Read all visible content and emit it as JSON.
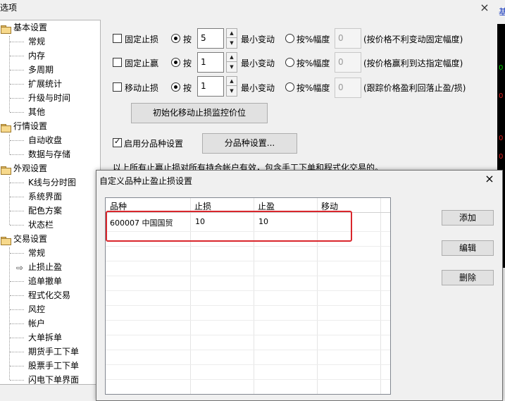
{
  "window": {
    "title": "选项",
    "close_icon": "×"
  },
  "tree": {
    "categories": [
      {
        "label": "基本设置",
        "items": [
          "常规",
          "内存",
          "多周期",
          "扩展统计",
          "升级与时间",
          "其他"
        ]
      },
      {
        "label": "行情设置",
        "items": [
          "自动收盘",
          "数据与存储"
        ]
      },
      {
        "label": "外观设置",
        "items": [
          "K线与分时图",
          "系统界面",
          "配色方案",
          "状态栏"
        ]
      },
      {
        "label": "交易设置",
        "items": [
          "常规",
          "止损止盈",
          "追单撤单",
          "程式化交易",
          "风控",
          "帐户",
          "大单拆单",
          "期货手工下单",
          "股票手工下单",
          "闪电下单界面"
        ]
      }
    ],
    "active_item": "止损止盈",
    "arrow": "⇨"
  },
  "settings": {
    "rows": [
      {
        "checkbox_label": "固定止损",
        "checked": false,
        "radio1_label": "按",
        "radio1_checked": true,
        "value": "5",
        "unit": "最小变动",
        "radio2_label": "按%幅度",
        "radio2_checked": false,
        "pct_value": "0",
        "hint": "(按价格不利变动固定幅度)"
      },
      {
        "checkbox_label": "固定止赢",
        "checked": false,
        "radio1_label": "按",
        "radio1_checked": true,
        "value": "1",
        "unit": "最小变动",
        "radio2_label": "按%幅度",
        "radio2_checked": false,
        "pct_value": "0",
        "hint": "(按价格赢利到达指定幅度)"
      },
      {
        "checkbox_label": "移动止损",
        "checked": false,
        "radio1_label": "按",
        "radio1_checked": true,
        "value": "1",
        "unit": "最小变动",
        "radio2_label": "按%幅度",
        "radio2_checked": false,
        "pct_value": "0",
        "hint": "(跟踪价格盈利回落止盈/损)"
      }
    ],
    "init_button": "初始化移动止损监控价位",
    "per_product_label": "启用分品种设置",
    "per_product_checked": true,
    "per_product_button": "分品种设置...",
    "note": "以上所有止赢止损对所有持合帐户有效，包含手工下单和程式化交易的。"
  },
  "dialog": {
    "title": "自定义品种止盈止损设置",
    "close_icon": "×",
    "columns": [
      "品种",
      "止损",
      "止盈",
      "移动"
    ],
    "rows": [
      {
        "product": "600007 中国国贸",
        "stop_loss": "10",
        "take_profit": "10",
        "trailing": ""
      }
    ],
    "buttons": {
      "add": "添加",
      "edit": "编辑",
      "delete": "删除"
    }
  },
  "background": {
    "tab_fragment": "基"
  },
  "colors": {
    "highlight": "#d9262c",
    "accent_blue": "#1a3cbf"
  }
}
